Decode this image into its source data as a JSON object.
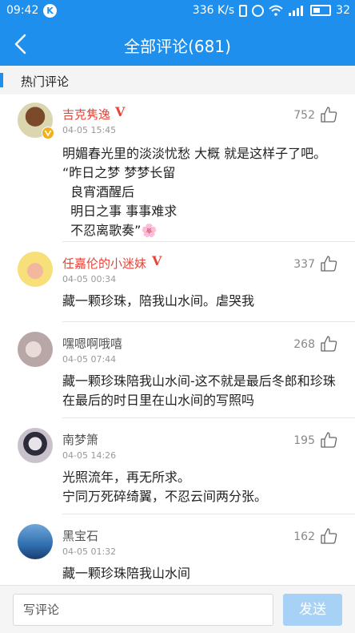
{
  "status_bar": {
    "time": "09:42",
    "app_badge": "K",
    "net_speed": "336 K/s",
    "battery": "32"
  },
  "header": {
    "title": "全部评论(681)"
  },
  "section": {
    "title": "热门评论"
  },
  "comments": [
    {
      "username": "吉克隽逸",
      "verified": "V",
      "time": "04-05 15:45",
      "likes": "752",
      "lines": [
        "明媚春光里的淡淡忧愁 大概 就是这样子了吧。",
        "“昨日之梦 梦梦长留",
        "  良宵酒醒后",
        "  明日之事 事事难求",
        "  不忍离歌奏”🌸"
      ]
    },
    {
      "username": "任嘉伦的小迷妹",
      "verified": "V",
      "time": "04-05 00:34",
      "likes": "337",
      "lines": [
        "藏一颗珍珠，陪我山水间。虐哭我"
      ]
    },
    {
      "username": "嘿嗯啊哦嘻",
      "time": "04-05 07:44",
      "likes": "268",
      "lines": [
        "藏一颗珍珠陪我山水间-这不就是最后冬郎和珍珠",
        "在最后的时日里在山水间的写照吗"
      ]
    },
    {
      "username": "南梦箫",
      "time": "04-05 14:26",
      "likes": "195",
      "lines": [
        "光照流年，再无所求。",
        "宁同万死碎绮翼，不忍云间两分张。"
      ]
    },
    {
      "username": "黑宝石",
      "time": "04-05 01:32",
      "likes": "162",
      "lines": [
        "藏一颗珍珠陪我山水间"
      ]
    }
  ],
  "bottom_bar": {
    "input_placeholder": "写评论",
    "send_label": "发送"
  },
  "colors": {
    "brand_blue": "#1e8fec",
    "vip_red": "#e2463a",
    "send_disabled": "#a7d2f6"
  }
}
